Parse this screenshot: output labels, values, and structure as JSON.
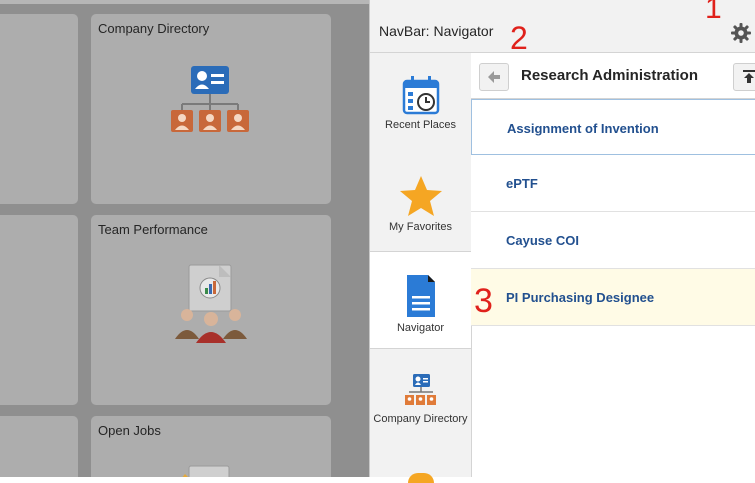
{
  "tiles": [
    {
      "title": "Company Directory",
      "icon": "org-chart-icon"
    },
    {
      "title": "Team Performance",
      "icon": "team-performance-icon"
    },
    {
      "title": "Open Jobs",
      "icon": "open-jobs-icon"
    }
  ],
  "panel": {
    "title": "NavBar: Navigator",
    "settings_icon": "gear-icon"
  },
  "rail": [
    {
      "label": "Recent Places",
      "icon": "clock-calendar-icon"
    },
    {
      "label": "My Favorites",
      "icon": "star-icon"
    },
    {
      "label": "Navigator",
      "icon": "document-icon"
    },
    {
      "label": "Company Directory",
      "icon": "org-chart-icon"
    }
  ],
  "navigator": {
    "back_icon": "back-arrow-icon",
    "title": "Research Administration",
    "top_icon": "back-to-top-icon",
    "items": [
      {
        "label": "Assignment of Invention"
      },
      {
        "label": "ePTF"
      },
      {
        "label": "Cayuse COI"
      },
      {
        "label": "PI Purchasing Designee"
      }
    ]
  },
  "annotations": [
    "1",
    "2",
    "3"
  ],
  "colors": {
    "link": "#22508f",
    "highlight_row": "#fffbe6",
    "annotation": "#e0211b",
    "star": "#f5a623",
    "doc_blue": "#2b7bd6",
    "org_orange": "#e07b39"
  }
}
